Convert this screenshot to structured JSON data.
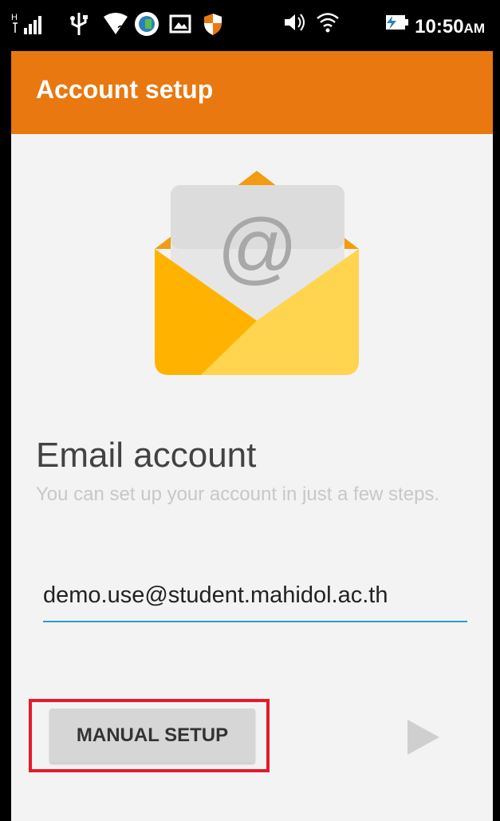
{
  "status_bar": {
    "network_label": "H",
    "time": "10:50",
    "time_suffix": "AM",
    "icons": [
      "signal-icon",
      "usb-icon",
      "wifi-question-icon",
      "app-update-icon",
      "image-icon",
      "shield-icon",
      "volume-icon",
      "wifi-icon",
      "battery-charging-icon"
    ]
  },
  "appbar": {
    "title": "Account setup"
  },
  "main": {
    "heading": "Email account",
    "subheading": "You can set up your account in just a few steps.",
    "email_value": "demo.use@student.mahidol.ac.th",
    "manual_setup_label": "MANUAL SETUP",
    "next_icon": "next-arrow-icon"
  },
  "colors": {
    "appbar": "#e8780f",
    "background": "#f3f3f3",
    "underline": "#2a9ec6",
    "highlight": "#e6192b",
    "envelope": "#ffca28"
  }
}
